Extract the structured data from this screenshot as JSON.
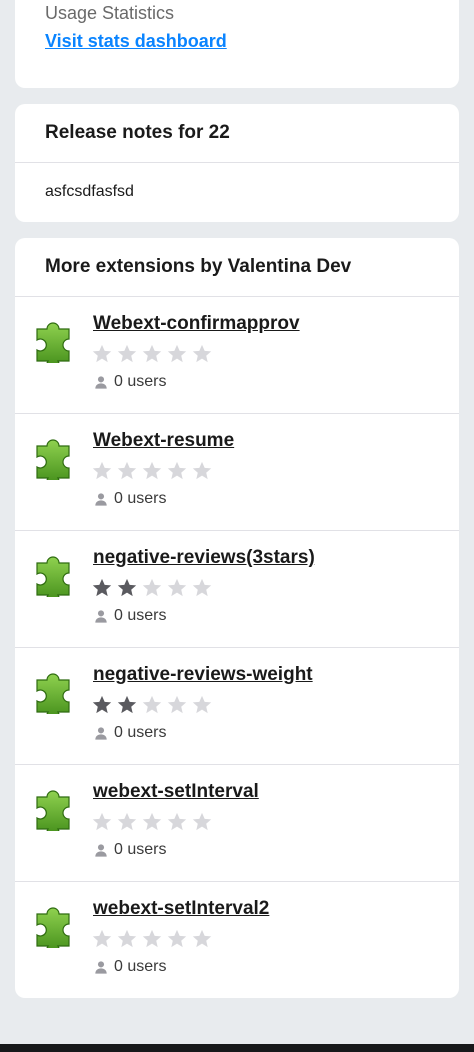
{
  "usage": {
    "title": "Usage Statistics",
    "link": "Visit stats dashboard"
  },
  "release": {
    "title": "Release notes for 22",
    "body": "asfcsdfasfsd"
  },
  "more": {
    "title": "More extensions by Valentina Dev",
    "items": [
      {
        "name": "Webext-confirmapprov",
        "rating": 0,
        "users": "0 users",
        "icon": "puzzle-icon"
      },
      {
        "name": "Webext-resume",
        "rating": 0,
        "users": "0 users",
        "icon": "puzzle-icon"
      },
      {
        "name": "negative-reviews(3stars)",
        "rating": 2,
        "users": "0 users",
        "icon": "puzzle-icon"
      },
      {
        "name": "negative-reviews-weight",
        "rating": 2,
        "users": "0 users",
        "icon": "puzzle-icon"
      },
      {
        "name": "webext-setInterval",
        "rating": 0,
        "users": "0 users",
        "icon": "puzzle-icon"
      },
      {
        "name": "webext-setInterval2",
        "rating": 0,
        "users": "0 users",
        "icon": "puzzle-icon"
      }
    ]
  },
  "colors": {
    "link": "#0a84ff",
    "star_filled": "#5a5a5f",
    "star_empty": "#d7d7db",
    "puzzle": "#5ea828"
  }
}
